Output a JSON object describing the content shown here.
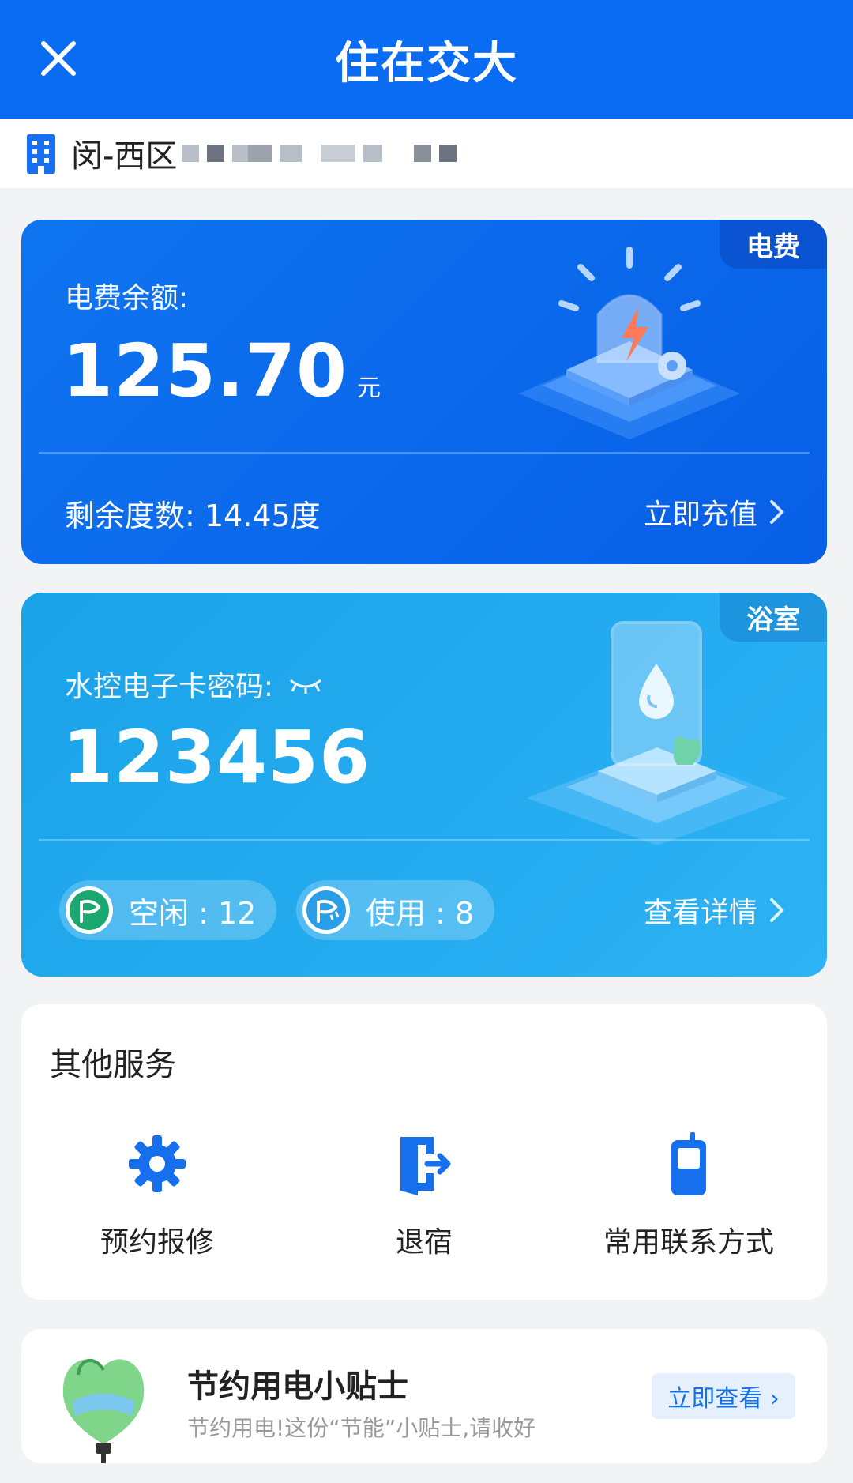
{
  "header": {
    "title": "住在交大",
    "close_icon": "close-icon"
  },
  "location": {
    "text": "闵-西区"
  },
  "electricity": {
    "tag": "电费",
    "balance_label": "电费余额:",
    "balance": "125.70",
    "unit": "元",
    "remaining_label": "剩余度数: 14.45度",
    "action": "立即充值"
  },
  "bathroom": {
    "tag": "浴室",
    "password_label": "水控电子卡密码:",
    "password": "123456",
    "idle_label": "空闲 : 12",
    "in_use_label": "使用 : 8",
    "action": "查看详情"
  },
  "services": {
    "title": "其他服务",
    "items": [
      {
        "label": "预约报修",
        "icon": "gear-icon"
      },
      {
        "label": "退宿",
        "icon": "checkout-door-icon"
      },
      {
        "label": "常用联系方式",
        "icon": "phone-icon"
      }
    ]
  },
  "tips": {
    "title": "节约用电小贴士",
    "subtitle": "节约用电!这份“节能”小贴士,请收好",
    "button": "立即查看 ›"
  },
  "colors": {
    "header": "#0a6cf2",
    "electric_card": "#0a68ed",
    "bath_card": "#23aaf0",
    "accent": "#1470e8"
  }
}
